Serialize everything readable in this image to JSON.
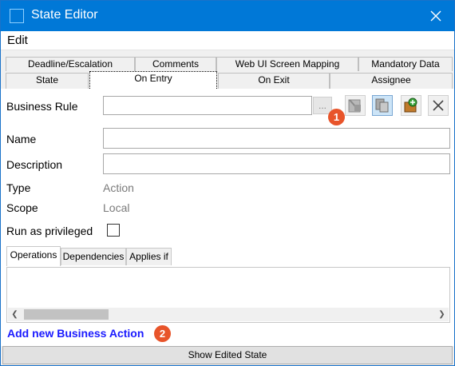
{
  "window": {
    "title": "State Editor"
  },
  "menu": {
    "edit": "Edit"
  },
  "tabs": {
    "row_back": [
      "Deadline/Escalation",
      "Comments",
      "Web UI Screen Mapping",
      "Mandatory Data"
    ],
    "row_front": [
      "State",
      "On Entry",
      "On Exit",
      "Assignee"
    ],
    "active": "On Entry"
  },
  "form": {
    "business_rule_label": "Business Rule",
    "business_rule_value": "",
    "ellipsis": "...",
    "name_label": "Name",
    "name_value": "",
    "description_label": "Description",
    "description_value": "",
    "type_label": "Type",
    "type_value": "Action",
    "scope_label": "Scope",
    "scope_value": "Local",
    "privileged_label": "Run as privileged",
    "privileged_checked": false
  },
  "toolbar": {
    "icons": [
      "rule-edit-icon",
      "rule-copy-icon",
      "rule-add-icon",
      "rule-delete-icon"
    ]
  },
  "subtabs": {
    "items": [
      "Operations",
      "Dependencies",
      "Applies if"
    ],
    "active": "Operations"
  },
  "actions": {
    "add_new": "Add new Business Action"
  },
  "badges": {
    "one": "1",
    "two": "2"
  },
  "footer": {
    "show_edited": "Show Edited State"
  },
  "colors": {
    "titlebar": "#0078d7",
    "badge": "#e8542a",
    "link": "#1a1aff"
  }
}
